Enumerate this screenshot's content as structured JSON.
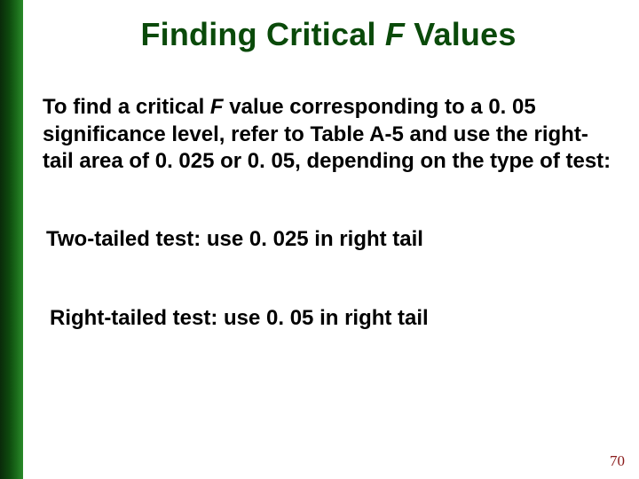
{
  "title": {
    "pre": "Finding Critical ",
    "italic": "F",
    "post": " Values"
  },
  "paragraph": {
    "pre": "To find a critical ",
    "italic": "F",
    "post": " value corresponding to a 0. 05 significance level, refer to Table A-5 and use the right-tail area of 0. 025 or 0. 05, depending on the type of test:"
  },
  "two_tailed": "Two-tailed test: use 0. 025 in right tail",
  "right_tailed": "Right-tailed test: use 0. 05 in right tail",
  "page_number": "70"
}
